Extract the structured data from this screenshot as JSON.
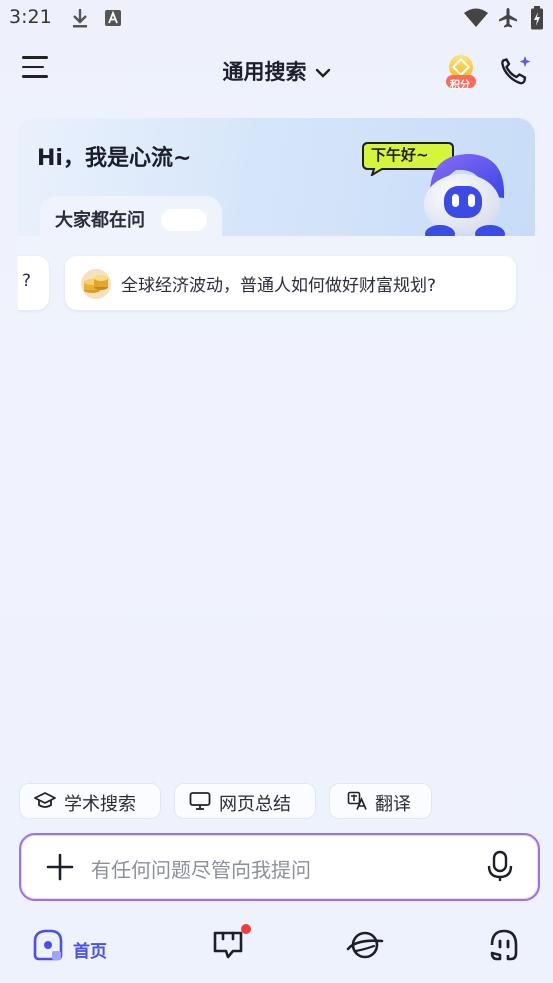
{
  "status_bar": {
    "time": "3:21",
    "left_icons": [
      "download-icon",
      "a-letter-icon"
    ],
    "right_icons": [
      "wifi-icon",
      "airplane-icon",
      "battery-icon"
    ]
  },
  "header": {
    "title": "通用搜索",
    "points_badge": "积分",
    "icons": [
      "menu-icon",
      "chevron-down-icon",
      "points-icon",
      "phone-sparkle-icon"
    ]
  },
  "card": {
    "greeting": "Hi，我是心流~",
    "bubble_text": "下午好~",
    "tab_label": "大家都在问",
    "questions": [
      {
        "text": "?"
      },
      {
        "text": "全球经济波动，普通人如何做好财富规划?"
      }
    ]
  },
  "tools": [
    {
      "label": "学术搜索",
      "icon": "graduation-cap-icon"
    },
    {
      "label": "网页总结",
      "icon": "monitor-icon"
    },
    {
      "label": "翻译",
      "icon": "translate-icon"
    }
  ],
  "input": {
    "placeholder": "有任何问题尽管向我提问",
    "icons": [
      "plus-icon",
      "microphone-icon"
    ]
  },
  "nav": {
    "home_label": "首页",
    "items": [
      "home-icon",
      "chat-icon",
      "planet-icon",
      "robot-icon"
    ]
  },
  "colors": {
    "accent": "#4a4ff0",
    "input_border": "#a06ef0",
    "badge_red": "#f23b3b",
    "bubble_green": "#d4f53c"
  }
}
